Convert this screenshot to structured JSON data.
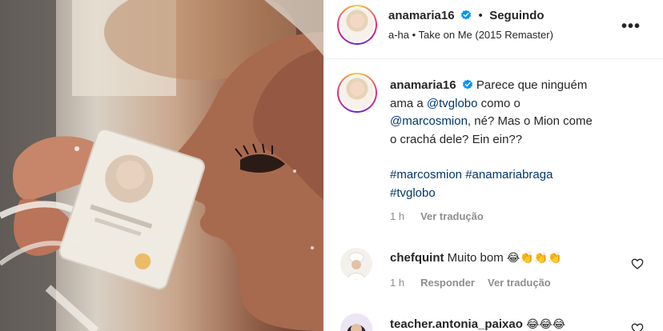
{
  "post": {
    "username": "anamaria16",
    "follow_state": "Seguindo",
    "audio": "a-ha • Take on Me (2015 Remaster)"
  },
  "caption": {
    "username": "anamaria16",
    "text_1": "Parece que ninguém",
    "text_2": "ama a",
    "mention_1": "@tvglobo",
    "text_3": "como o",
    "mention_2": "@marcosmion",
    "text_4": ", né? Mas o Mion come",
    "text_5": "o crachá dele? Ein ein??",
    "hashtags_line1": "#marcosmion #anamariabraga",
    "hashtags_line2": "#tvglobo",
    "time": "1 h",
    "translate": "Ver tradução"
  },
  "comments": [
    {
      "username": "chefquint",
      "text": "Muito bom",
      "emojis": "😂👏👏👏",
      "time": "1 h",
      "reply": "Responder",
      "translate": "Ver tradução"
    },
    {
      "username": "teacher.antonia_paixao",
      "emojis": "😂😂😂"
    }
  ],
  "icons": {
    "more": "more-options-icon",
    "verified": "verified-badge-icon",
    "like": "heart-icon"
  },
  "colors": {
    "link": "#00376b",
    "verified": "#0095f6",
    "muted": "#8e8e8e"
  }
}
